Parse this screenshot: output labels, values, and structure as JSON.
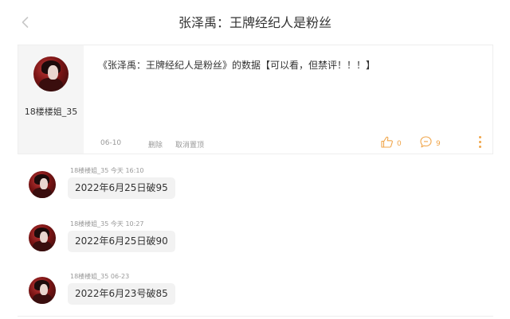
{
  "header": {
    "title": "张泽禹：王牌经纪人是粉丝"
  },
  "post": {
    "username": "18楼楼姐_35",
    "text": "《张泽禹：王牌经纪人是粉丝》的数据【可以看，但禁评！！！】",
    "date": "06-10",
    "delete_label": "删除",
    "unpin_label": "取消置顶",
    "like_count": "0",
    "comment_count": "9"
  },
  "replies": [
    {
      "username": "18楼楼姐_35",
      "time": "今天 16:10",
      "text": "2022年6月25日破95"
    },
    {
      "username": "18楼楼姐_35",
      "time": "今天 10:27",
      "text": "2022年6月25日破90"
    },
    {
      "username": "18楼楼姐_35",
      "time": "06-23",
      "text": "2022年6月23号破85"
    }
  ],
  "colors": {
    "accent": "#f0a54a",
    "muted": "#999999",
    "text": "#333333",
    "bubble": "#f2f2f2"
  },
  "icons": [
    "back-chevron-icon",
    "thumbs-up-icon",
    "comment-icon",
    "more-vertical-icon"
  ]
}
